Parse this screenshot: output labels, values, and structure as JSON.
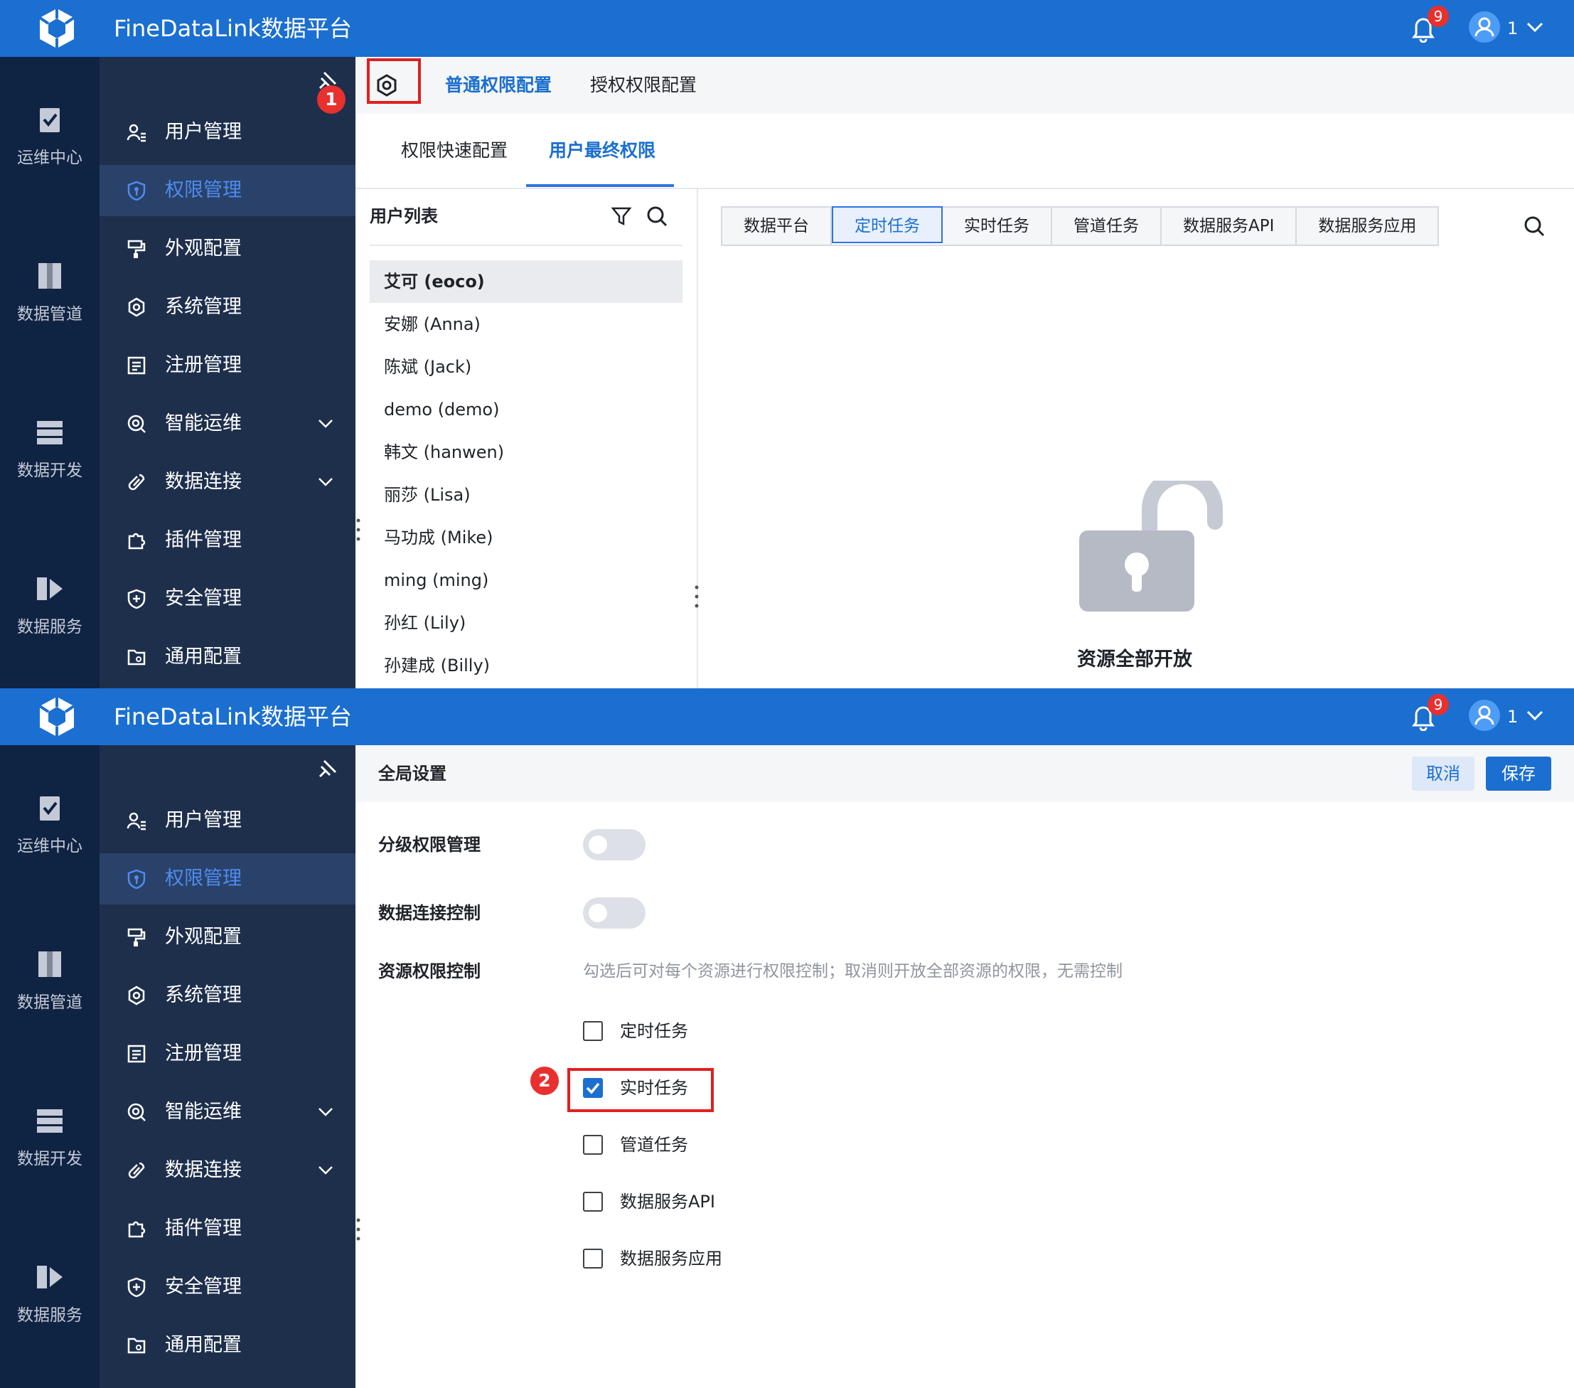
{
  "app": {
    "title": "FineDataLink数据平台",
    "notification_count": "9",
    "user_name": "1"
  },
  "rail": [
    {
      "label": "运维中心",
      "icon": "clipboard-check-icon"
    },
    {
      "label": "数据管道",
      "icon": "pipeline-icon"
    },
    {
      "label": "数据开发",
      "icon": "dev-stack-icon"
    },
    {
      "label": "数据服务",
      "icon": "data-service-icon"
    }
  ],
  "menu": [
    {
      "label": "用户管理",
      "icon": "user-list-icon"
    },
    {
      "label": "权限管理",
      "icon": "shield-key-icon",
      "active": true
    },
    {
      "label": "外观配置",
      "icon": "paint-roller-icon"
    },
    {
      "label": "系统管理",
      "icon": "gear-icon"
    },
    {
      "label": "注册管理",
      "icon": "register-icon"
    },
    {
      "label": "智能运维",
      "icon": "smart-ops-icon",
      "expandable": true
    },
    {
      "label": "数据连接",
      "icon": "link-icon",
      "expandable": true
    },
    {
      "label": "插件管理",
      "icon": "puzzle-icon"
    },
    {
      "label": "安全管理",
      "icon": "shield-plus-icon"
    },
    {
      "label": "通用配置",
      "icon": "folder-gear-icon"
    }
  ],
  "panel1": {
    "marker": "1",
    "top_tabs": [
      "普通权限配置",
      "授权权限配置"
    ],
    "sub_tabs": [
      "权限快速配置",
      "用户最终权限"
    ],
    "user_list_title": "用户列表",
    "users": [
      "艾可 (eoco)",
      "安娜 (Anna)",
      "陈斌 (Jack)",
      "demo (demo)",
      "韩文 (hanwen)",
      "丽莎 (Lisa)",
      "马功成 (Mike)",
      "ming (ming)",
      "孙红 (Lily)",
      "孙建成 (Billy)"
    ],
    "resource_tabs": [
      "数据平台",
      "定时任务",
      "实时任务",
      "管道任务",
      "数据服务API",
      "数据服务应用"
    ],
    "active_resource_tab": "定时任务",
    "empty_text": "资源全部开放"
  },
  "panel2": {
    "marker": "2",
    "header_title": "全局设置",
    "cancel_label": "取消",
    "save_label": "保存",
    "settings": [
      {
        "label": "分级权限管理",
        "enabled": false
      },
      {
        "label": "数据连接控制",
        "enabled": false
      }
    ],
    "resource_control_label": "资源权限控制",
    "resource_hint": "勾选后可对每个资源进行权限控制；取消则开放全部资源的权限，无需控制",
    "resources": [
      {
        "label": "定时任务",
        "checked": false
      },
      {
        "label": "实时任务",
        "checked": true
      },
      {
        "label": "管道任务",
        "checked": false
      },
      {
        "label": "数据服务API",
        "checked": false
      },
      {
        "label": "数据服务应用",
        "checked": false
      }
    ]
  },
  "colors": {
    "topbar": "#1b6fd0",
    "rail": "#0f2343",
    "menu": "#1e2f4c",
    "menu_active": "#2a4269",
    "accent": "#2f73e0",
    "marker": "#e8302e"
  }
}
